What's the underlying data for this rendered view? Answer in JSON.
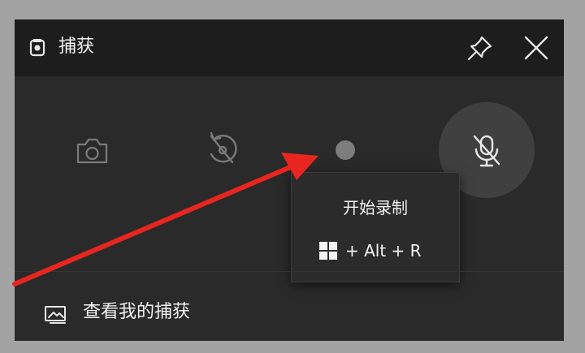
{
  "titlebar": {
    "title": "捕获",
    "app_icon": "capture-icon",
    "pin_icon": "pin-icon",
    "close_icon": "close-icon"
  },
  "controls": {
    "screenshot_icon": "camera-icon",
    "last_seconds_icon": "record-last-30s-icon",
    "record_icon": "record-dot-icon",
    "mic_icon": "mic-muted-icon"
  },
  "tooltip": {
    "title": "开始录制",
    "shortcut_icon": "windows-logo-icon",
    "shortcut": "+ Alt + R"
  },
  "footer": {
    "icon": "gallery-icon",
    "label": "查看我的捕获"
  },
  "colors": {
    "annotation_arrow": "#e8251f",
    "titlebar_bg": "#1d1d1d",
    "panel_bg": "#2a2a2a",
    "text": "#f2f2f2"
  }
}
